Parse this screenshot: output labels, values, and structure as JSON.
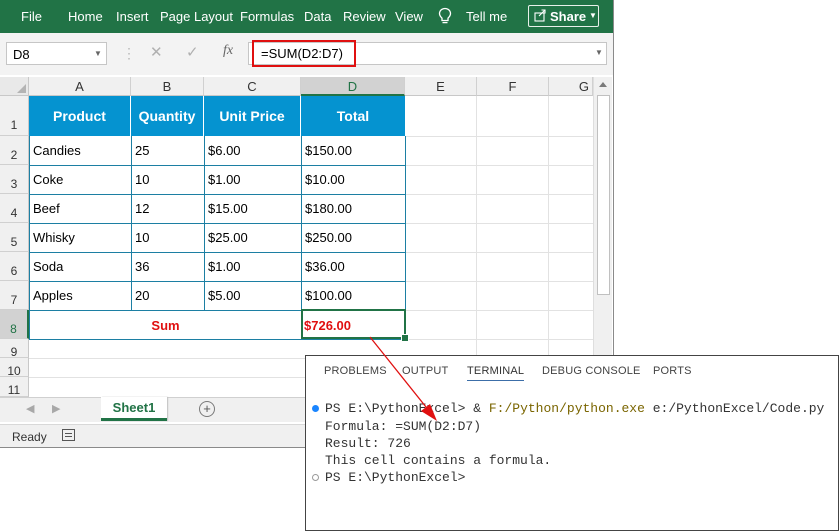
{
  "excel": {
    "ribbon_tabs": [
      "File",
      "Home",
      "Insert",
      "Page Layout",
      "Formulas",
      "Data",
      "Review",
      "View"
    ],
    "tell_me": "Tell me",
    "share_label": "Share",
    "name_box": "D8",
    "formula": "=SUM(D2:D7)",
    "columns": [
      "A",
      "B",
      "C",
      "D",
      "E",
      "F",
      "G"
    ],
    "rows": [
      "1",
      "2",
      "3",
      "4",
      "5",
      "6",
      "7",
      "8",
      "9",
      "10",
      "11"
    ],
    "headers": [
      "Product",
      "Quantity",
      "Unit Price",
      "Total"
    ],
    "data_rows": [
      [
        "Candies",
        "25",
        "$6.00",
        "$150.00"
      ],
      [
        "Coke",
        "10",
        "$1.00",
        "$10.00"
      ],
      [
        "Beef",
        "12",
        "$15.00",
        "$180.00"
      ],
      [
        "Whisky",
        "10",
        "$25.00",
        "$250.00"
      ],
      [
        "Soda",
        "36",
        "$1.00",
        "$36.00"
      ],
      [
        "Apples",
        "20",
        "$5.00",
        "$100.00"
      ]
    ],
    "sum_label": "Sum",
    "sum_value": "$726.00",
    "sheet_tab": "Sheet1",
    "status": "Ready",
    "accent_color": "#217346",
    "header_color": "#0593d0",
    "highlight_color": "#e01010",
    "icons": [
      "lightbulb-icon",
      "share-icon",
      "cancel-icon",
      "enter-icon",
      "function-icon",
      "add-sheet-icon",
      "page-layout-icon"
    ]
  },
  "terminal": {
    "tabs": [
      "PROBLEMS",
      "OUTPUT",
      "TERMINAL",
      "DEBUG CONSOLE",
      "PORTS"
    ],
    "active_tab": "TERMINAL",
    "prompt": "PS E:\\PythonExcel>",
    "cmd_amp": "&",
    "cmd_exe": "F:/Python/python.exe",
    "cmd_arg": "e:/PythonExcel/Code.py",
    "lines": [
      "Formula: =SUM(D2:D7)",
      "Result: 726",
      "This cell contains a formula."
    ],
    "prompt2": "PS E:\\PythonExcel>"
  }
}
